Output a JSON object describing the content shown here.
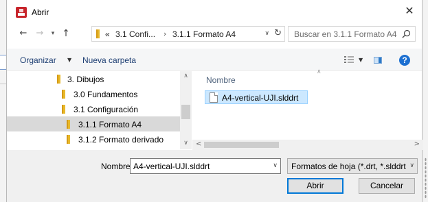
{
  "window": {
    "title": "Abrir"
  },
  "nav": {
    "address_crumbs": [
      "«",
      "3.1 Confi...",
      "›",
      "3.1.1 Formato A4"
    ],
    "search_placeholder": "Buscar en 3.1.1 Formato A4"
  },
  "toolbar": {
    "organize_label": "Organizar",
    "new_folder_label": "Nueva carpeta"
  },
  "tree": [
    {
      "label": "3. Dibujos",
      "selected": false
    },
    {
      "label": "3.0 Fundamentos",
      "selected": false
    },
    {
      "label": "3.1 Configuración",
      "selected": false
    },
    {
      "label": "3.1.1 Formato A4",
      "selected": true
    },
    {
      "label": "3.1.2 Formato derivado",
      "selected": false
    }
  ],
  "content": {
    "column_header": "Nombre",
    "files": [
      {
        "name": "A4-vertical-UJI.slddrt",
        "selected": true
      }
    ]
  },
  "footer": {
    "filename_label": "Nombre:",
    "filename_value": "A4-vertical-UJI.slddrt",
    "filter_value": "Formatos de hoja (*.drt, *.slddrt",
    "open_label": "Abrir",
    "cancel_label": "Cancelar"
  },
  "colors": {
    "accent": "#0078d7",
    "selection": "#cce8ff",
    "folder": "#e8b82a",
    "help": "#1c6fd1"
  },
  "icons": [
    "app-icon",
    "close-icon",
    "back-arrow-icon",
    "forward-arrow-icon",
    "recent-locations-icon",
    "up-arrow-icon",
    "folder-icon",
    "refresh-icon",
    "search-icon",
    "view-options-icon",
    "preview-pane-icon",
    "help-icon",
    "file-icon"
  ]
}
